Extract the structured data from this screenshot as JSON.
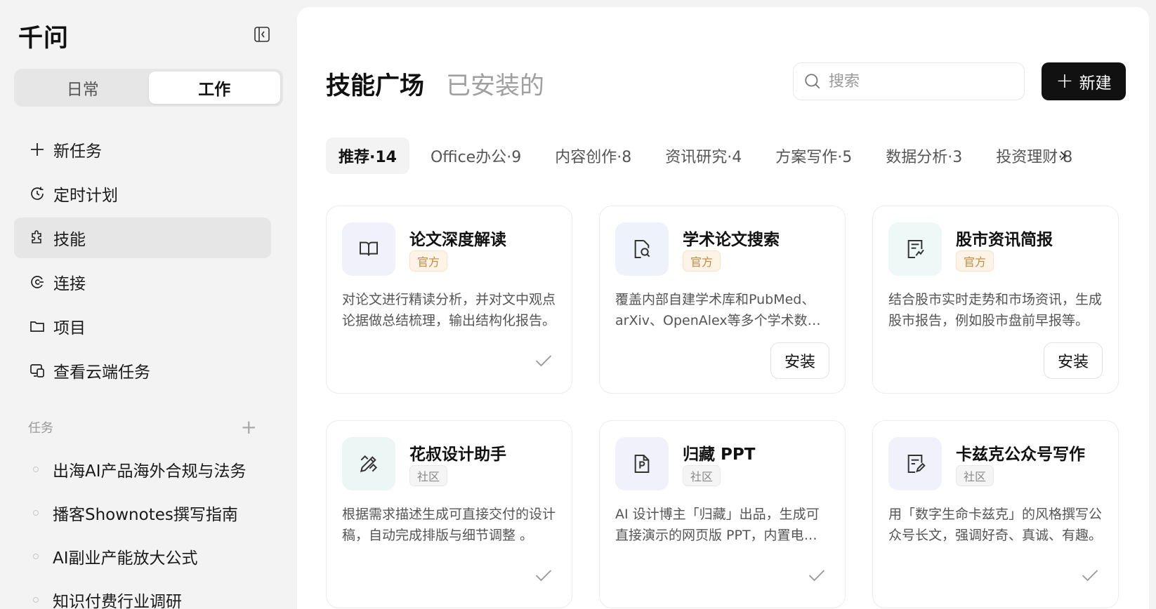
{
  "app": {
    "title": "千问"
  },
  "mode_switch": {
    "options": [
      "日常",
      "工作"
    ],
    "active": 1
  },
  "nav": [
    {
      "label": "新任务",
      "icon": "plus-icon"
    },
    {
      "label": "定时计划",
      "icon": "clock-refresh-icon"
    },
    {
      "label": "技能",
      "icon": "puzzle-icon",
      "active": true
    },
    {
      "label": "连接",
      "icon": "link-circle-icon"
    },
    {
      "label": "项目",
      "icon": "folder-icon"
    },
    {
      "label": "查看云端任务",
      "icon": "cloud-device-icon"
    }
  ],
  "tasks": {
    "header": "任务",
    "items": [
      "出海AI产品海外合规与法务",
      "播客Shownotes撰写指南",
      "AI副业产能放大公式",
      "知识付费行业调研"
    ]
  },
  "main": {
    "tabs": [
      "技能广场",
      "已安装的"
    ],
    "search_placeholder": "搜索",
    "new_label": "新建",
    "categories": [
      "推荐·14",
      "Office办公·9",
      "内容创作·8",
      "资讯研究·4",
      "方案写作·5",
      "数据分析·3",
      "投资理财·8"
    ],
    "cards": [
      {
        "title": "论文深度解读",
        "badge": "官方",
        "badge_type": "official",
        "desc": "对论文进行精读分析，并对文中观点论据做总结梳理，输出结构化报告。",
        "installed": true,
        "icon": "open-book-icon",
        "icon_bg": "#f1f1fb"
      },
      {
        "title": "学术论文搜索",
        "badge": "官方",
        "badge_type": "official",
        "desc": "覆盖内部自建学术库和PubMed、arXiv、OpenAlex等多个学术数据库。",
        "installed": false,
        "install_label": "安装",
        "icon": "document-search-icon",
        "icon_bg": "#eef3fb"
      },
      {
        "title": "股市资讯简报",
        "badge": "官方",
        "badge_type": "official",
        "desc": "结合股市实时走势和市场资讯，生成股市报告，例如股市盘前早报等。",
        "installed": false,
        "install_label": "安装",
        "icon": "document-chart-icon",
        "icon_bg": "#eef8f6"
      },
      {
        "title": "花叔设计助手",
        "badge": "社区",
        "badge_type": "community",
        "desc": "根据需求描述生成可直接交付的设计稿，自动完成排版与细节调整 。",
        "installed": true,
        "icon": "design-tools-icon",
        "icon_bg": "#ecf7f5"
      },
      {
        "title": "归藏 PPT",
        "badge": "社区",
        "badge_type": "community",
        "desc": "AI 设计博主「归藏」出品，生成可直接演示的网页版 PPT，内置电影感模板。",
        "installed": true,
        "icon": "ppt-file-icon",
        "icon_bg": "#f1f1fb"
      },
      {
        "title": "卡兹克公众号写作",
        "badge": "社区",
        "badge_type": "community",
        "desc": "用「数字生命卡兹克」的风格撰写公众号长文，强调好奇、真诚、有趣。",
        "installed": true,
        "icon": "note-edit-icon",
        "icon_bg": "#f1f1fb"
      }
    ]
  }
}
